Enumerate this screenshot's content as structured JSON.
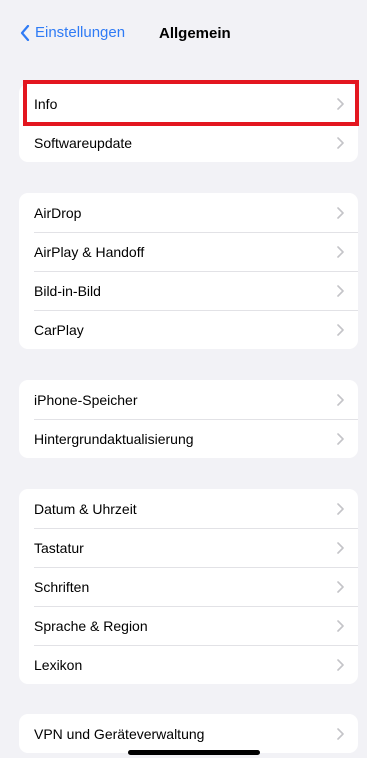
{
  "nav": {
    "back_label": "Einstellungen",
    "title": "Allgemein"
  },
  "groups": [
    {
      "items": [
        "Info",
        "Softwareupdate"
      ]
    },
    {
      "items": [
        "AirDrop",
        "AirPlay & Handoff",
        "Bild-in-Bild",
        "CarPlay"
      ]
    },
    {
      "items": [
        "iPhone-Speicher",
        "Hintergrundaktualisierung"
      ]
    },
    {
      "items": [
        "Datum & Uhrzeit",
        "Tastatur",
        "Schriften",
        "Sprache & Region",
        "Lexikon"
      ]
    },
    {
      "items": [
        "VPN und Geräteverwaltung"
      ]
    }
  ],
  "colors": {
    "accent": "#2f7bf5",
    "background": "#f2f2f6",
    "highlight": "#e3161f"
  }
}
